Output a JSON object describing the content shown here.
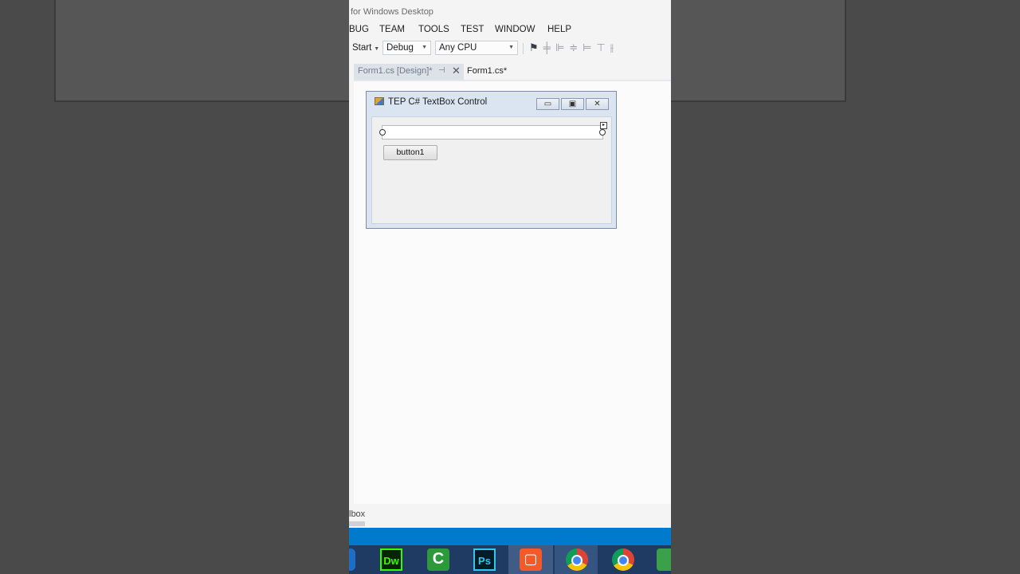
{
  "window": {
    "title_fragment": "for Windows Desktop"
  },
  "menu": [
    "BUG",
    "TEAM",
    "TOOLS",
    "TEST",
    "WINDOW",
    "HELP"
  ],
  "toolbar": {
    "start_label": "Start",
    "configuration": "Debug",
    "platform": "Any CPU"
  },
  "tabs": {
    "inactive": "Form1.cs [Design]*",
    "active": "Form1.cs*",
    "pin_glyph": "⊣",
    "close_glyph": "✕"
  },
  "form": {
    "caption": "TEP C# TextBox Control",
    "textbox_value": "",
    "button_label": "button1"
  },
  "bottom_panel": {
    "tab_fragment": "lbox"
  },
  "taskbar": {
    "apps": [
      {
        "label": "Dw",
        "color": "#35fa00"
      },
      {
        "label": "Ps",
        "color": "#31c5f0"
      }
    ]
  },
  "colors": {
    "status_bar": "#007acc",
    "taskbar": "#1f3a63",
    "designer_bg": "#fbfbfb"
  }
}
